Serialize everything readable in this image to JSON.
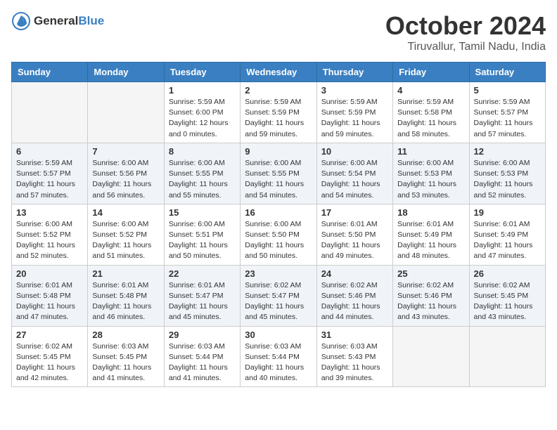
{
  "header": {
    "logo_general": "General",
    "logo_blue": "Blue",
    "month": "October 2024",
    "location": "Tiruvallur, Tamil Nadu, India"
  },
  "weekdays": [
    "Sunday",
    "Monday",
    "Tuesday",
    "Wednesday",
    "Thursday",
    "Friday",
    "Saturday"
  ],
  "weeks": [
    [
      {
        "day": "",
        "info": ""
      },
      {
        "day": "",
        "info": ""
      },
      {
        "day": "1",
        "info": "Sunrise: 5:59 AM\nSunset: 6:00 PM\nDaylight: 12 hours and 0 minutes."
      },
      {
        "day": "2",
        "info": "Sunrise: 5:59 AM\nSunset: 5:59 PM\nDaylight: 11 hours and 59 minutes."
      },
      {
        "day": "3",
        "info": "Sunrise: 5:59 AM\nSunset: 5:59 PM\nDaylight: 11 hours and 59 minutes."
      },
      {
        "day": "4",
        "info": "Sunrise: 5:59 AM\nSunset: 5:58 PM\nDaylight: 11 hours and 58 minutes."
      },
      {
        "day": "5",
        "info": "Sunrise: 5:59 AM\nSunset: 5:57 PM\nDaylight: 11 hours and 57 minutes."
      }
    ],
    [
      {
        "day": "6",
        "info": "Sunrise: 5:59 AM\nSunset: 5:57 PM\nDaylight: 11 hours and 57 minutes."
      },
      {
        "day": "7",
        "info": "Sunrise: 6:00 AM\nSunset: 5:56 PM\nDaylight: 11 hours and 56 minutes."
      },
      {
        "day": "8",
        "info": "Sunrise: 6:00 AM\nSunset: 5:55 PM\nDaylight: 11 hours and 55 minutes."
      },
      {
        "day": "9",
        "info": "Sunrise: 6:00 AM\nSunset: 5:55 PM\nDaylight: 11 hours and 54 minutes."
      },
      {
        "day": "10",
        "info": "Sunrise: 6:00 AM\nSunset: 5:54 PM\nDaylight: 11 hours and 54 minutes."
      },
      {
        "day": "11",
        "info": "Sunrise: 6:00 AM\nSunset: 5:53 PM\nDaylight: 11 hours and 53 minutes."
      },
      {
        "day": "12",
        "info": "Sunrise: 6:00 AM\nSunset: 5:53 PM\nDaylight: 11 hours and 52 minutes."
      }
    ],
    [
      {
        "day": "13",
        "info": "Sunrise: 6:00 AM\nSunset: 5:52 PM\nDaylight: 11 hours and 52 minutes."
      },
      {
        "day": "14",
        "info": "Sunrise: 6:00 AM\nSunset: 5:52 PM\nDaylight: 11 hours and 51 minutes."
      },
      {
        "day": "15",
        "info": "Sunrise: 6:00 AM\nSunset: 5:51 PM\nDaylight: 11 hours and 50 minutes."
      },
      {
        "day": "16",
        "info": "Sunrise: 6:00 AM\nSunset: 5:50 PM\nDaylight: 11 hours and 50 minutes."
      },
      {
        "day": "17",
        "info": "Sunrise: 6:01 AM\nSunset: 5:50 PM\nDaylight: 11 hours and 49 minutes."
      },
      {
        "day": "18",
        "info": "Sunrise: 6:01 AM\nSunset: 5:49 PM\nDaylight: 11 hours and 48 minutes."
      },
      {
        "day": "19",
        "info": "Sunrise: 6:01 AM\nSunset: 5:49 PM\nDaylight: 11 hours and 47 minutes."
      }
    ],
    [
      {
        "day": "20",
        "info": "Sunrise: 6:01 AM\nSunset: 5:48 PM\nDaylight: 11 hours and 47 minutes."
      },
      {
        "day": "21",
        "info": "Sunrise: 6:01 AM\nSunset: 5:48 PM\nDaylight: 11 hours and 46 minutes."
      },
      {
        "day": "22",
        "info": "Sunrise: 6:01 AM\nSunset: 5:47 PM\nDaylight: 11 hours and 45 minutes."
      },
      {
        "day": "23",
        "info": "Sunrise: 6:02 AM\nSunset: 5:47 PM\nDaylight: 11 hours and 45 minutes."
      },
      {
        "day": "24",
        "info": "Sunrise: 6:02 AM\nSunset: 5:46 PM\nDaylight: 11 hours and 44 minutes."
      },
      {
        "day": "25",
        "info": "Sunrise: 6:02 AM\nSunset: 5:46 PM\nDaylight: 11 hours and 43 minutes."
      },
      {
        "day": "26",
        "info": "Sunrise: 6:02 AM\nSunset: 5:45 PM\nDaylight: 11 hours and 43 minutes."
      }
    ],
    [
      {
        "day": "27",
        "info": "Sunrise: 6:02 AM\nSunset: 5:45 PM\nDaylight: 11 hours and 42 minutes."
      },
      {
        "day": "28",
        "info": "Sunrise: 6:03 AM\nSunset: 5:45 PM\nDaylight: 11 hours and 41 minutes."
      },
      {
        "day": "29",
        "info": "Sunrise: 6:03 AM\nSunset: 5:44 PM\nDaylight: 11 hours and 41 minutes."
      },
      {
        "day": "30",
        "info": "Sunrise: 6:03 AM\nSunset: 5:44 PM\nDaylight: 11 hours and 40 minutes."
      },
      {
        "day": "31",
        "info": "Sunrise: 6:03 AM\nSunset: 5:43 PM\nDaylight: 11 hours and 39 minutes."
      },
      {
        "day": "",
        "info": ""
      },
      {
        "day": "",
        "info": ""
      }
    ]
  ]
}
